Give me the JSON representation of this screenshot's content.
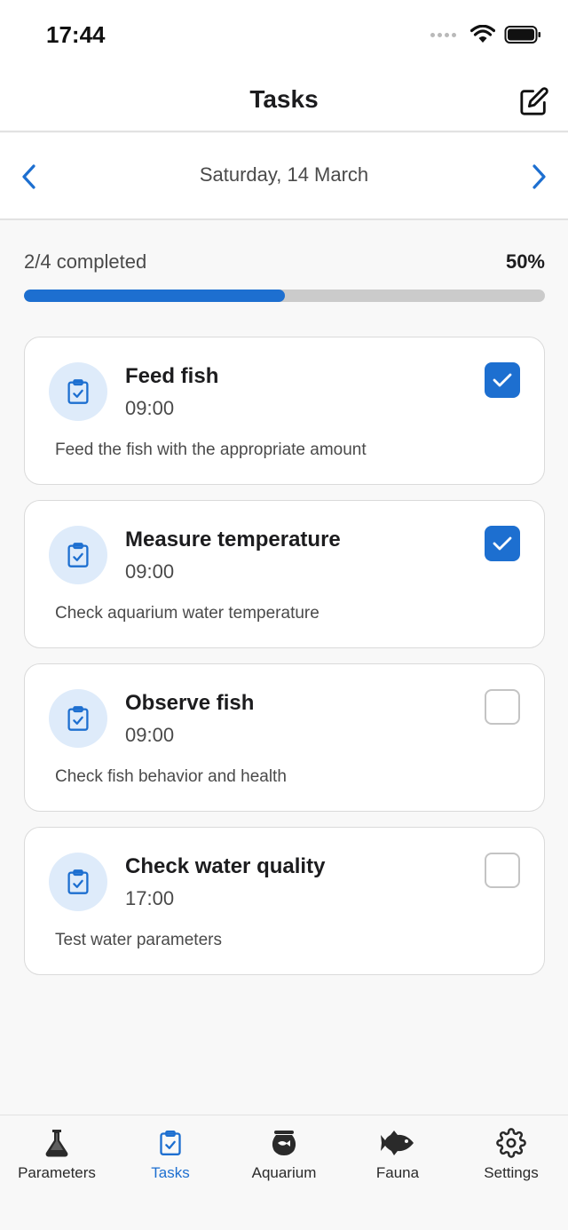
{
  "status_bar": {
    "time": "17:44"
  },
  "header": {
    "title": "Tasks",
    "edit_icon": "edit-icon"
  },
  "date_nav": {
    "date": "Saturday, 14 March",
    "prev_icon": "chevron-left-icon",
    "next_icon": "chevron-right-icon"
  },
  "progress": {
    "text": "2/4 completed",
    "percent_label": "50%",
    "fraction": 0.5
  },
  "tasks": [
    {
      "title": "Feed fish",
      "time": "09:00",
      "description": "Feed the fish with the appropriate amount",
      "completed": true
    },
    {
      "title": "Measure temperature",
      "time": "09:00",
      "description": "Check aquarium water temperature",
      "completed": true
    },
    {
      "title": "Observe fish",
      "time": "09:00",
      "description": "Check fish behavior and health",
      "completed": false
    },
    {
      "title": "Check water quality",
      "time": "17:00",
      "description": "Test water parameters",
      "completed": false
    }
  ],
  "tabbar": {
    "items": [
      {
        "label": "Parameters",
        "icon": "flask-icon",
        "active": false
      },
      {
        "label": "Tasks",
        "icon": "clipboard-check-icon",
        "active": true
      },
      {
        "label": "Aquarium",
        "icon": "fishbowl-icon",
        "active": false
      },
      {
        "label": "Fauna",
        "icon": "fish-icon",
        "active": false
      },
      {
        "label": "Settings",
        "icon": "gear-icon",
        "active": false
      }
    ]
  },
  "colors": {
    "accent": "#1d6fd0",
    "icon_circle": "#deebfa",
    "track": "#cbcbcb",
    "text_secondary": "#4a4a4a"
  }
}
